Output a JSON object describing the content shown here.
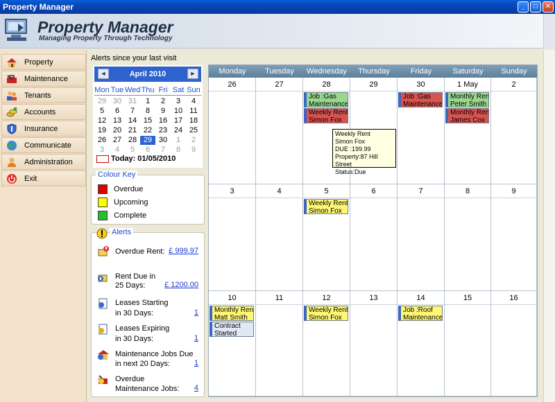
{
  "window": {
    "title": "Property Manager"
  },
  "header": {
    "app_name": "Property Manager",
    "tagline": "Managing Property Through Technology"
  },
  "sidebar": {
    "items": [
      {
        "label": "Property",
        "icon": "house-icon"
      },
      {
        "label": "Maintenance",
        "icon": "toolbox-icon"
      },
      {
        "label": "Tenants",
        "icon": "people-icon"
      },
      {
        "label": "Accounts",
        "icon": "coins-icon"
      },
      {
        "label": "Insurance",
        "icon": "shield-icon"
      },
      {
        "label": "Communicate",
        "icon": "globe-icon"
      },
      {
        "label": "Administration",
        "icon": "user-icon"
      },
      {
        "label": "Exit",
        "icon": "power-icon"
      }
    ]
  },
  "alerts_caption": "Alerts since your last visit",
  "mini_calendar": {
    "month_label": "April 2010",
    "prev": "◄",
    "next": "►",
    "dow": [
      "Mon",
      "Tue",
      "Wed",
      "Thu",
      "Fri",
      "Sat",
      "Sun"
    ],
    "weeks": [
      [
        "29",
        "30",
        "31",
        "1",
        "2",
        "3",
        "4"
      ],
      [
        "5",
        "6",
        "7",
        "8",
        "9",
        "10",
        "11"
      ],
      [
        "12",
        "13",
        "14",
        "15",
        "16",
        "17",
        "18"
      ],
      [
        "19",
        "20",
        "21",
        "22",
        "23",
        "24",
        "25"
      ],
      [
        "26",
        "27",
        "28",
        "29",
        "30",
        "1",
        "2"
      ],
      [
        "3",
        "4",
        "5",
        "6",
        "7",
        "8",
        "9"
      ]
    ],
    "today_label": "Today: 01/05/2010"
  },
  "colour_key": {
    "title": "Colour Key",
    "items": [
      {
        "label": "Overdue",
        "color": "#e00000"
      },
      {
        "label": "Upcoming",
        "color": "#ffff00"
      },
      {
        "label": "Complete",
        "color": "#22c02a"
      }
    ]
  },
  "alerts": {
    "title": "Alerts",
    "items": [
      {
        "line1": "Overdue Rent:",
        "line2": "",
        "value": "£ 999.97"
      },
      {
        "line1": "Rent Due in",
        "line2": "25 Days:",
        "value": "£ 1200.00"
      },
      {
        "line1": "Leases Starting",
        "line2": "in 30 Days:",
        "value": "1"
      },
      {
        "line1": "Leases Expiring",
        "line2": "in 30 Days:",
        "value": "1"
      },
      {
        "line1": "Maintenance Jobs Due",
        "line2": "in next 20 Days:",
        "value": "1"
      },
      {
        "line1": "Overdue",
        "line2": "Maintenance Jobs:",
        "value": "4"
      }
    ]
  },
  "calendar": {
    "dow": [
      "Monday",
      "Tuesday",
      "Wednesday",
      "Thursday",
      "Friday",
      "Saturday",
      "Sunday"
    ],
    "weeks": [
      [
        "26",
        "27",
        "28",
        "29",
        "30",
        "1 May",
        "2"
      ],
      [
        "3",
        "4",
        "5",
        "6",
        "7",
        "8",
        "9"
      ],
      [
        "10",
        "11",
        "12",
        "13",
        "14",
        "15",
        "16"
      ]
    ],
    "events": [
      {
        "lines": [
          "Job :Gas",
          "Maintenance"
        ],
        "color": "green"
      },
      {
        "lines": [
          "Weekly Rent",
          "Simon Fox"
        ],
        "color": "red"
      },
      {
        "lines": [
          "Job :Gas",
          "Maintenance"
        ],
        "color": "red"
      },
      {
        "lines": [
          "Monthly Rent",
          "Peter Smith"
        ],
        "color": "green"
      },
      {
        "lines": [
          "Monthly Rent",
          "James Cox"
        ],
        "color": "red"
      },
      {
        "lines": [
          "Weekly Rent",
          "Simon Fox"
        ],
        "color": "yellow"
      },
      {
        "lines": [
          "Monthly Rent",
          "Matt Smith"
        ],
        "color": "yellow"
      },
      {
        "lines": [
          "Contract",
          "Started"
        ],
        "color": "blue"
      },
      {
        "lines": [
          "Weekly Rent",
          "Simon Fox"
        ],
        "color": "yellow"
      },
      {
        "lines": [
          "Job :Roof",
          "Maintenance"
        ],
        "color": "yellow"
      }
    ],
    "tooltip": [
      "Weekly Rent",
      "Simon Fox",
      "DUE :199.99",
      "Property:87 Hill Street",
      "Status:Due"
    ]
  }
}
